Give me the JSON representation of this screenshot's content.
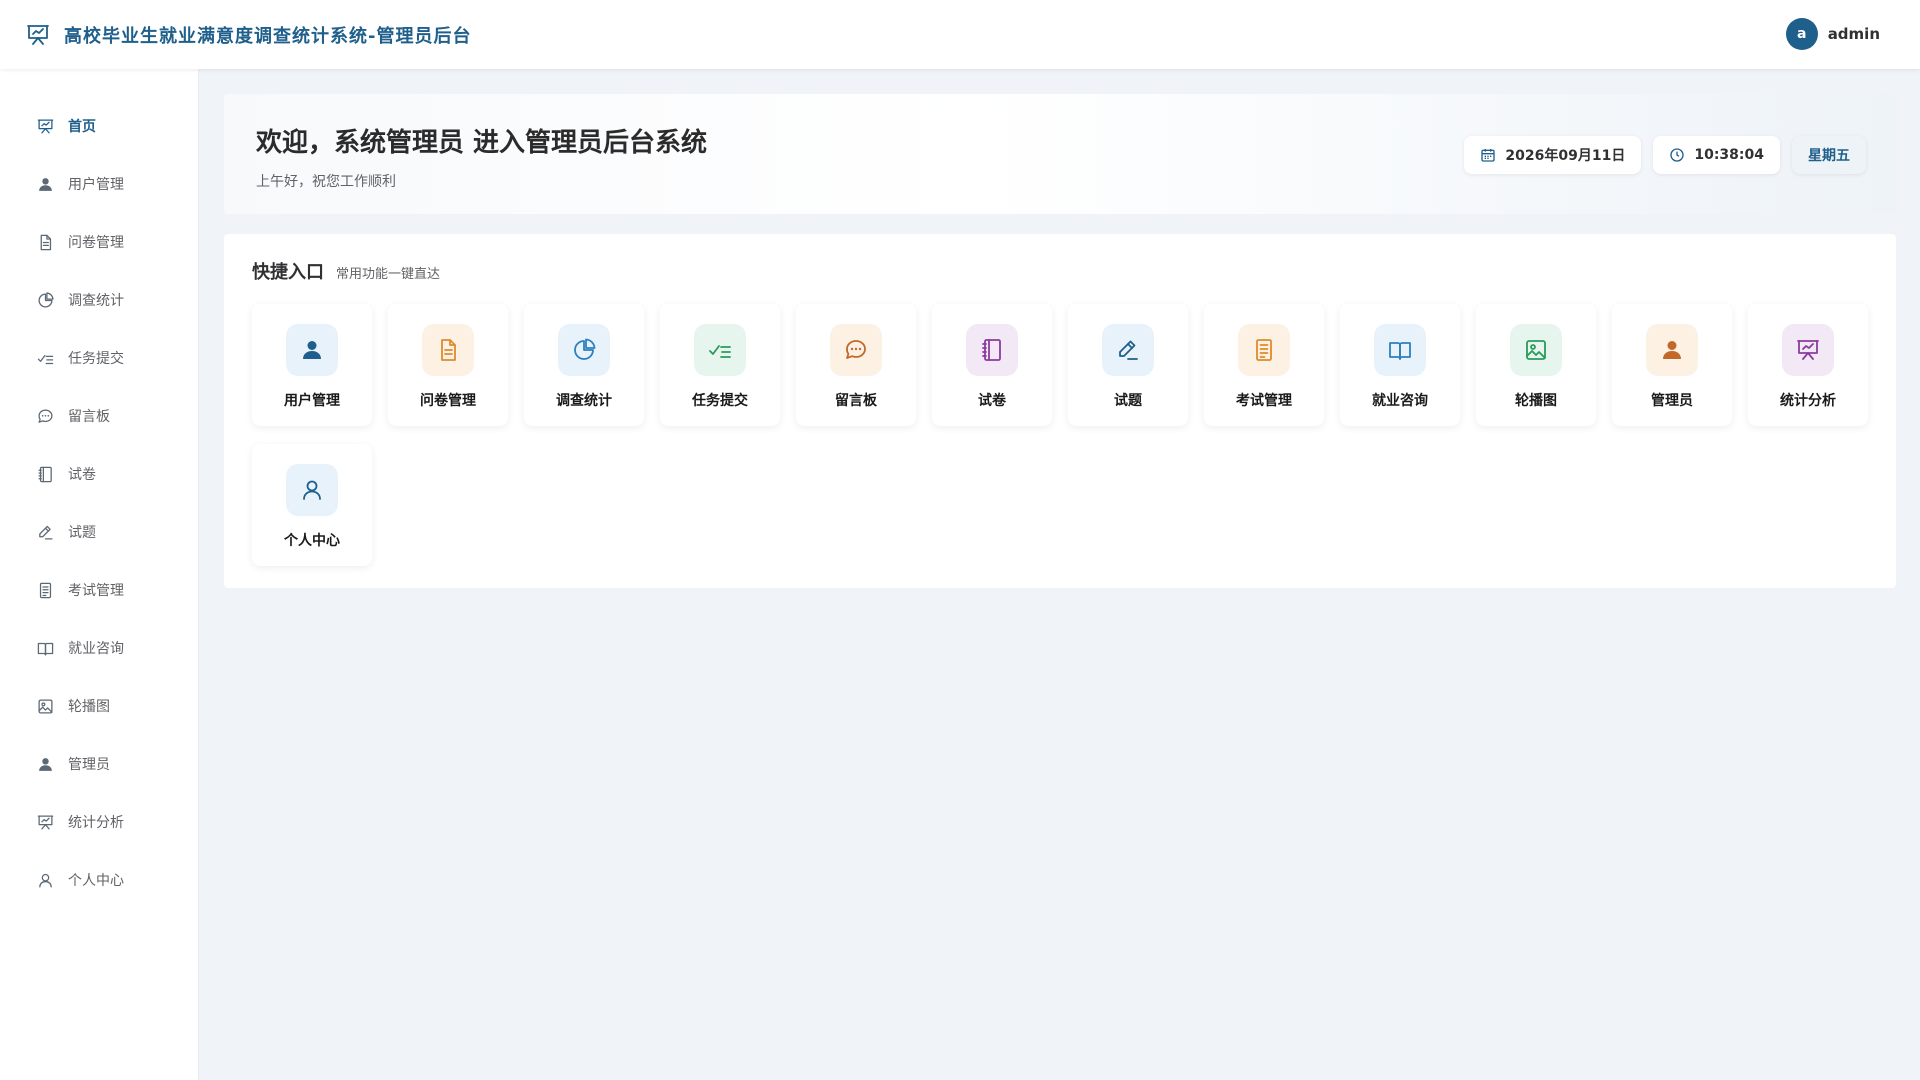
{
  "app": {
    "title": "高校毕业生就业满意度调查统计系统-管理员后台",
    "logo_icon": "presentation-chart-icon"
  },
  "user": {
    "avatar_letter": "a",
    "name": "admin"
  },
  "sidebar": {
    "items": [
      {
        "label": "首页",
        "icon": "home",
        "active": true
      },
      {
        "label": "用户管理",
        "icon": "user-solid"
      },
      {
        "label": "问卷管理",
        "icon": "document"
      },
      {
        "label": "调查统计",
        "icon": "pie"
      },
      {
        "label": "任务提交",
        "icon": "check-list"
      },
      {
        "label": "留言板",
        "icon": "chat"
      },
      {
        "label": "试卷",
        "icon": "notebook"
      },
      {
        "label": "试题",
        "icon": "pen"
      },
      {
        "label": "考试管理",
        "icon": "doc-lines"
      },
      {
        "label": "就业咨询",
        "icon": "book"
      },
      {
        "label": "轮播图",
        "icon": "image"
      },
      {
        "label": "管理员",
        "icon": "user-solid"
      },
      {
        "label": "统计分析",
        "icon": "presentation"
      },
      {
        "label": "个人中心",
        "icon": "user-outline"
      }
    ]
  },
  "welcome": {
    "title": "欢迎，系统管理员 进入管理员后台系统",
    "subtitle": "上午好，祝您工作顺利",
    "date": "2026年09月11日",
    "time": "10:38:04",
    "weekday": "星期五"
  },
  "quick": {
    "title": "快捷入口",
    "subtitle": "常用功能一键直达",
    "items": [
      {
        "label": "用户管理",
        "icon": "user-solid",
        "bg": "#e8f2fb",
        "color": "#1f5f8b"
      },
      {
        "label": "问卷管理",
        "icon": "document",
        "bg": "#fdf1e4",
        "color": "#e08a2c"
      },
      {
        "label": "调查统计",
        "icon": "pie",
        "bg": "#e8f2fb",
        "color": "#2d7fbf"
      },
      {
        "label": "任务提交",
        "icon": "check-list",
        "bg": "#e6f6ee",
        "color": "#2b9a5c"
      },
      {
        "label": "留言板",
        "icon": "chat",
        "bg": "#fdf1e4",
        "color": "#c2692a"
      },
      {
        "label": "试卷",
        "icon": "notebook",
        "bg": "#f3e8f6",
        "color": "#8a3c9c"
      },
      {
        "label": "试题",
        "icon": "pen",
        "bg": "#e8f2fb",
        "color": "#1f5f8b"
      },
      {
        "label": "考试管理",
        "icon": "doc-lines",
        "bg": "#fdf1e4",
        "color": "#e08a2c"
      },
      {
        "label": "就业咨询",
        "icon": "book",
        "bg": "#e8f2fb",
        "color": "#2d7fbf"
      },
      {
        "label": "轮播图",
        "icon": "image",
        "bg": "#e6f6ee",
        "color": "#2b9a5c"
      },
      {
        "label": "管理员",
        "icon": "user-solid",
        "bg": "#fdf1e4",
        "color": "#c2692a"
      },
      {
        "label": "统计分析",
        "icon": "presentation",
        "bg": "#f3e8f6",
        "color": "#8a3c9c"
      },
      {
        "label": "个人中心",
        "icon": "user-outline",
        "bg": "#e8f2fb",
        "color": "#1f5f8b"
      }
    ]
  },
  "colors": {
    "brand": "#1f5f8b",
    "background": "#f0f3f7"
  }
}
